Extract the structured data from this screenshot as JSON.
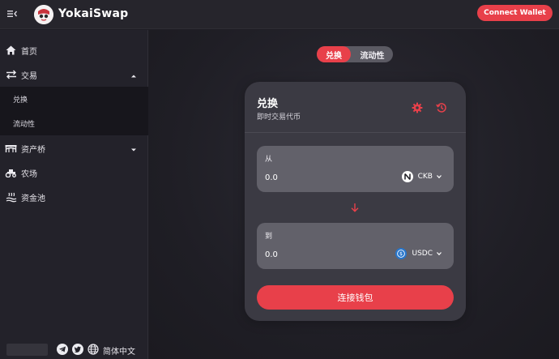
{
  "app": {
    "brand": "YokaiSwap",
    "connect_wallet_label": "Connect Wallet"
  },
  "sidebar": {
    "items": [
      {
        "label": "首页",
        "icon": "home-icon"
      },
      {
        "label": "交易",
        "icon": "swap-arrows-icon",
        "expanded": true,
        "children": [
          {
            "label": "兑换"
          },
          {
            "label": "流动性"
          }
        ]
      },
      {
        "label": "资产桥",
        "icon": "bridge-icon",
        "expanded": false
      },
      {
        "label": "农场",
        "icon": "tractor-icon"
      },
      {
        "label": "资金池",
        "icon": "pool-icon"
      }
    ],
    "footer": {
      "language": "简体中文",
      "icons": [
        "telegram-icon",
        "twitter-icon",
        "globe-icon"
      ]
    }
  },
  "tabs": {
    "swap": "兑换",
    "liquidity": "流动性",
    "active": "swap"
  },
  "card": {
    "title": "兑换",
    "subtitle": "即时交易代币",
    "from": {
      "label": "从",
      "value": "0.0",
      "token": "CKB"
    },
    "to": {
      "label": "到",
      "value": "0.0",
      "token": "USDC"
    },
    "connect_label": "连接钱包"
  },
  "colors": {
    "accent": "#e8404a",
    "background": "#1e1d24",
    "card": "#3b3a43",
    "panel": "#62616a"
  }
}
